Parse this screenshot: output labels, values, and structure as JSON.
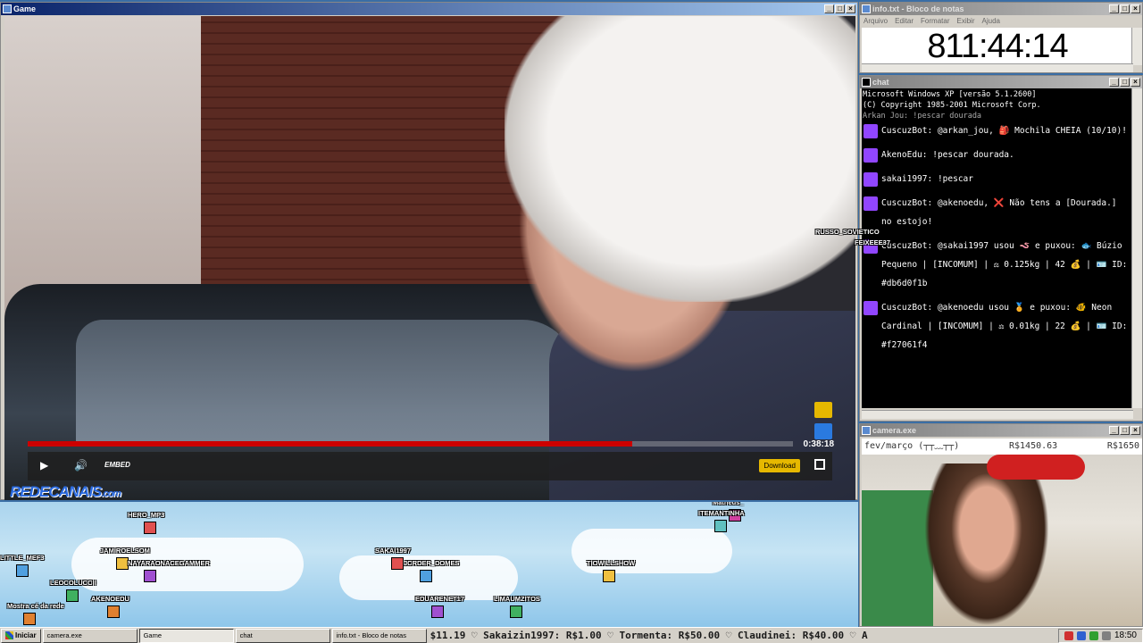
{
  "game_window": {
    "title": "Game",
    "video": {
      "timecode": "0:38:18",
      "progress_fraction": 0.79,
      "embed_label": "EMBED",
      "download_label": "Download",
      "watermark": "REDECANAIS",
      "watermark_suffix": ".com"
    }
  },
  "info_window": {
    "title": "info.txt - Bloco de notas",
    "menu": [
      "Arquivo",
      "Editar",
      "Formatar",
      "Exibir",
      "Ajuda"
    ],
    "content": "811:44:14"
  },
  "chat_window": {
    "title": "chat",
    "header_line1": "Microsoft Windows XP [versão 5.1.2600]",
    "header_line2": "(C) Copyright 1985-2001 Microsoft Corp.",
    "partial_line": "Arkan_Jou: !pescar dourada",
    "messages": [
      {
        "user": "CuscuzBot",
        "text": "@arkan_jou, 🎒 Mochila CHEIA (10/10)!"
      },
      {
        "user": "AkenoEdu",
        "text": "!pescar dourada."
      },
      {
        "user": "sakai1997",
        "text": "!pescar"
      },
      {
        "user": "CuscuzBot",
        "text": "@akenoedu, ❌ Não tens a [Dourada.] no estojo!"
      },
      {
        "user": "CuscuzBot",
        "text": "@sakai1997 usou 🪱 e puxou: 🐟 Búzio Pequeno | [INCOMUM] | ⚖ 0.125kg | 42 💰 | 🪪 ID: #db6d0f1b"
      },
      {
        "user": "CuscuzBot",
        "text": "@akenoedu usou 🏅 e puxou: 🐠 Neon Cardinal | [INCOMUM] | ⚖ 0.01kg | 22 💰 | 🪪 ID: #f27061f4"
      }
    ],
    "overlay_names": [
      "RUSSO_SOVIETICO",
      "FEIXEEE37"
    ]
  },
  "camera_window": {
    "title": "camera.exe",
    "label_left": "fev/março (┬┬﹏┬┬)",
    "label_mid": "R$1450.63",
    "label_right": "R$1650"
  },
  "sky_players": [
    {
      "name": "HERO_MP3"
    },
    {
      "name": "LITTLE_MEF3"
    },
    {
      "name": "JAMIROELSOM"
    },
    {
      "name": "NAYARAONACEGAMMER"
    },
    {
      "name": "LEOCOLUCCII"
    },
    {
      "name": "AKENOEDU"
    },
    {
      "name": "Matheus_"
    },
    {
      "name": "ITEMANTINHA"
    },
    {
      "name": "SAKAI1997"
    },
    {
      "name": "JCRDER_DOMES"
    },
    {
      "name": "TIOWILLSHOW"
    },
    {
      "name": "EDUARENET17"
    },
    {
      "name": "LIMAUMZITOS"
    },
    {
      "name": "Mostra cé da rede"
    }
  ],
  "taskbar": {
    "start_label": "Iniciar",
    "tasks": [
      "camera.exe",
      "Game",
      "chat",
      "info.txt - Bloco de notas"
    ],
    "active_task": 1,
    "ticker": "$11.19  ♡ Sakaizin1997: R$1.00  ♡ Tormenta: R$50.00  ♡ Claudinei: R$40.00  ♡ A",
    "clock": "18:50"
  },
  "colors": {
    "titlebar_active": "#0a246a",
    "twitch": "#9146ff",
    "progress": "#cc0000",
    "download": "#e6b800"
  }
}
